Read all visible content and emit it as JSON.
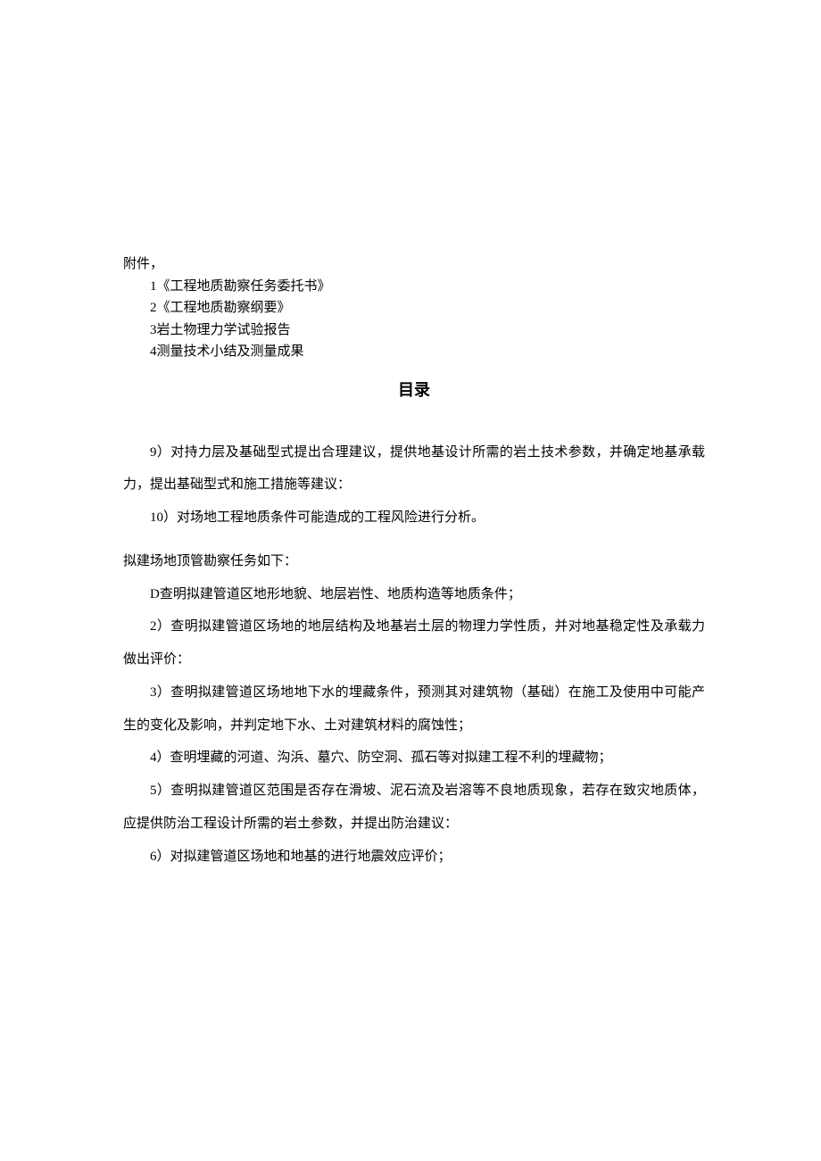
{
  "attachments": {
    "header": "附件，",
    "items": [
      "1《工程地质勘察任务委托书》",
      "2《工程地质勘察纲要》",
      "3岩土物理力学试验报告",
      "4测量技术小结及测量成果"
    ]
  },
  "toc_title": "目录",
  "paragraphs": {
    "p9": "9）对持力层及基础型式提出合理建议，提供地基设计所需的岩土技术参数，并确定地基承载力，提出基础型式和施工措施等建议：",
    "p10": "10）对场地工程地质条件可能造成的工程风险进行分析。",
    "task_intro": "拟建场地顶管勘察任务如下：",
    "d": "D查明拟建管道区地形地貌、地层岩性、地质构造等地质条件；",
    "t2": "2）查明拟建管道区场地的地层结构及地基岩土层的物理力学性质，并对地基稳定性及承载力做出评价：",
    "t3": "3）查明拟建管道区场地地下水的埋藏条件，预测其对建筑物（基础）在施工及使用中可能产生的变化及影响，并判定地下水、土对建筑材料的腐蚀性；",
    "t4": "4）查明埋藏的河道、沟浜、墓穴、防空洞、孤石等对拟建工程不利的埋藏物；",
    "t5": "5）查明拟建管道区范围是否存在滑坡、泥石流及岩溶等不良地质现象，若存在致灾地质体，应提供防治工程设计所需的岩土参数，并提出防治建议：",
    "t6": "6）对拟建管道区场地和地基的进行地震效应评价；"
  }
}
